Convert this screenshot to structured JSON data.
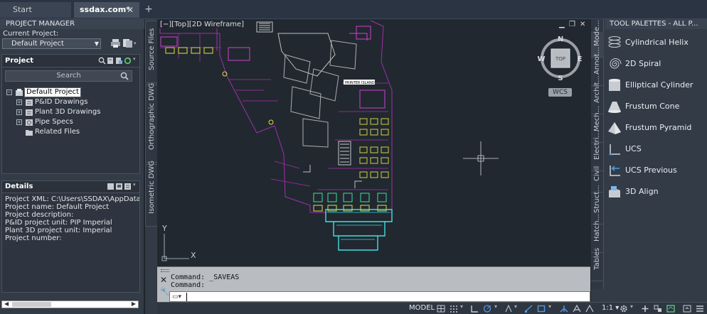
{
  "tabs": {
    "start": "Start",
    "file": "ssdax.com*",
    "close": "✕",
    "add": "+"
  },
  "pm": {
    "title": "PROJECT MANAGER",
    "current_label": "Current Project:",
    "current_value": "Default Project",
    "project_header": "Project",
    "search_placeholder": "Search",
    "tree": [
      "Default Project",
      "P&ID Drawings",
      "Plant 3D Drawings",
      "Pipe Specs",
      "Related Files"
    ],
    "details_header": "Details",
    "details": [
      "Project XML:  C:\\Users\\SSDAX\\AppData\\Roa",
      "Project name:  Default Project",
      "Project description:",
      "P&ID project unit:  PIP Imperial",
      "Plant 3D project unit:  Imperial",
      "Project number:"
    ]
  },
  "side_tabs": [
    "Source Files",
    "Orthographic DWG",
    "Isometric DWG"
  ],
  "viewport": {
    "label": "[−][Top][2D Wireframe]",
    "compass": {
      "n": "N",
      "s": "S",
      "e": "E",
      "w": "W",
      "face": "TOP"
    },
    "wcs": "WCS",
    "ucs_y": "Y",
    "ucs_x": "X",
    "room_label": "PRINTER ISLAND"
  },
  "command": {
    "history": [
      "Command:  _SAVEAS",
      "Command:"
    ],
    "prompt_icon": "▭▾"
  },
  "tool_palette": {
    "title": "TOOL PALETTES - ALL P...",
    "tabs": [
      "Mode...",
      "Annot...",
      "Archit...",
      "Mech...",
      "Electri...",
      "Civil",
      "Struct...",
      "Hatch...",
      "Tables"
    ],
    "tools": [
      "Cylindrical Helix",
      "2D Spiral",
      "Elliptical Cylinder",
      "Frustum Cone",
      "Frustum Pyramid",
      "UCS",
      "UCS Previous",
      "3D Align"
    ]
  },
  "status": {
    "model": "MODEL",
    "scale": "1:1 ▾"
  },
  "colors": {
    "accent": "#4d9be6",
    "wall": "#a030a8",
    "furniture": "#e0e040",
    "room": "#d040d0",
    "glass": "#40e0e0",
    "background": "#212830"
  }
}
